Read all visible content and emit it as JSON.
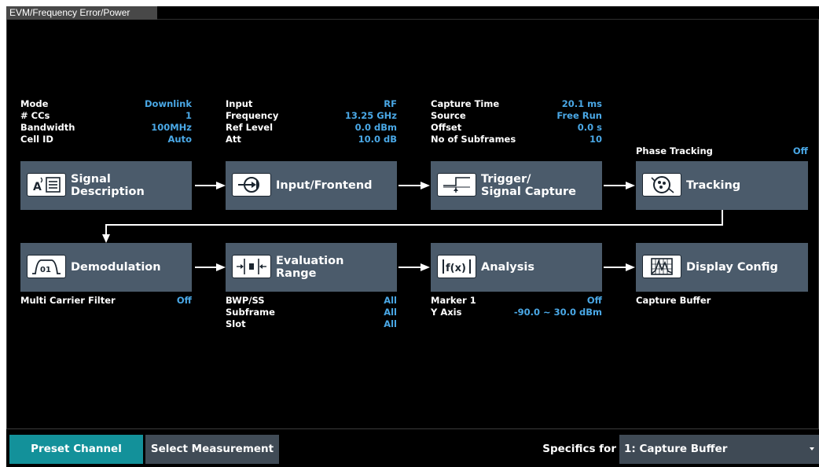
{
  "title": "EVM/Frequency Error/Power",
  "colors": {
    "panel_bg": "#000000",
    "block_bg": "#4b5b6b",
    "value_text": "#4aa8e6",
    "preset_bg": "#13919a"
  },
  "signal_info": [
    {
      "label": "Mode",
      "value": "Downlink"
    },
    {
      "label": "# CCs",
      "value": "1"
    },
    {
      "label": "Bandwidth",
      "value": "100MHz"
    },
    {
      "label": "Cell ID",
      "value": "Auto"
    }
  ],
  "input_info": [
    {
      "label": "Input",
      "value": "RF"
    },
    {
      "label": "Frequency",
      "value": "13.25 GHz"
    },
    {
      "label": "Ref Level",
      "value": "0.0 dBm"
    },
    {
      "label": "Att",
      "value": "10.0 dB"
    }
  ],
  "capture_info": [
    {
      "label": "Capture Time",
      "value": "20.1 ms"
    },
    {
      "label": "Source",
      "value": "Free Run"
    },
    {
      "label": "Offset",
      "value": "0.0 s"
    },
    {
      "label": "No of Subframes",
      "value": "10"
    }
  ],
  "tracking_info": [
    {
      "label": "Phase Tracking",
      "value": "Off"
    }
  ],
  "blocks": {
    "signal_description": {
      "line1": "Signal",
      "line2": "Description",
      "icon": "antenna-list-icon"
    },
    "input_frontend": {
      "line1": "Input/Frontend",
      "icon": "input-arrow-icon"
    },
    "trigger": {
      "line1": "Trigger/",
      "line2": "Signal Capture",
      "icon": "trigger-edge-icon"
    },
    "tracking": {
      "line1": "Tracking",
      "icon": "tracking-target-icon"
    },
    "demodulation": {
      "line1": "Demodulation",
      "icon": "demod-bits-icon"
    },
    "evaluation_range": {
      "line1": "Evaluation",
      "line2": "Range",
      "icon": "range-brackets-icon"
    },
    "analysis": {
      "line1": "Analysis",
      "icon": "function-icon"
    },
    "display_config": {
      "line1": "Display Config",
      "icon": "display-chart-icon"
    }
  },
  "demod_info": [
    {
      "label": "Multi Carrier Filter",
      "value": "Off"
    }
  ],
  "eval_info": [
    {
      "label": "BWP/SS",
      "value": "All"
    },
    {
      "label": "Subframe",
      "value": "All"
    },
    {
      "label": "Slot",
      "value": "All"
    }
  ],
  "analysis_info": [
    {
      "label": "Marker 1",
      "value": "Off"
    },
    {
      "label": "Y Axis",
      "value": "-90.0 ~ 30.0 dBm"
    }
  ],
  "display_info": [
    {
      "label": "Capture Buffer",
      "value": ""
    }
  ],
  "footer": {
    "preset_label": "Preset Channel",
    "select_label": "Select Measurement",
    "specifics_label": "Specifics for",
    "specifics_value": "1: Capture Buffer"
  }
}
